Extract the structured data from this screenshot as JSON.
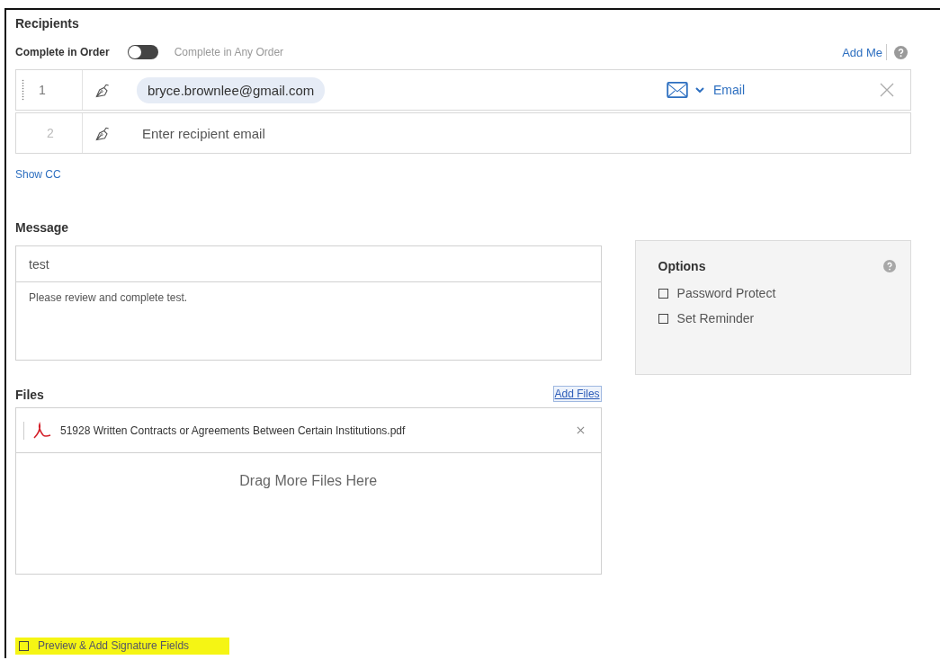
{
  "section_title": "Recipients",
  "order_toggle": {
    "left_label": "Complete in Order",
    "right_label": "Complete in Any Order",
    "on": false
  },
  "add_me": "Add Me",
  "recipients": [
    {
      "number": "1",
      "email": "bryce.brownlee@gmail.com",
      "delivery": "Email"
    },
    {
      "number": "2",
      "placeholder": "Enter recipient email"
    }
  ],
  "show_cc": "Show CC",
  "message": {
    "title": "Message",
    "subject": "test",
    "body": "Please review and complete test."
  },
  "options": {
    "title": "Options",
    "items": [
      {
        "label": "Password Protect",
        "checked": false
      },
      {
        "label": "Set Reminder",
        "checked": false
      }
    ]
  },
  "files": {
    "title": "Files",
    "add_files": "Add Files",
    "items": [
      {
        "name": "51928 Written Contracts or Agreements Between Certain Institutions.pdf"
      }
    ],
    "drop_hint": "Drag More Files Here"
  },
  "preview": {
    "label": "Preview & Add Signature Fields",
    "checked": false
  }
}
